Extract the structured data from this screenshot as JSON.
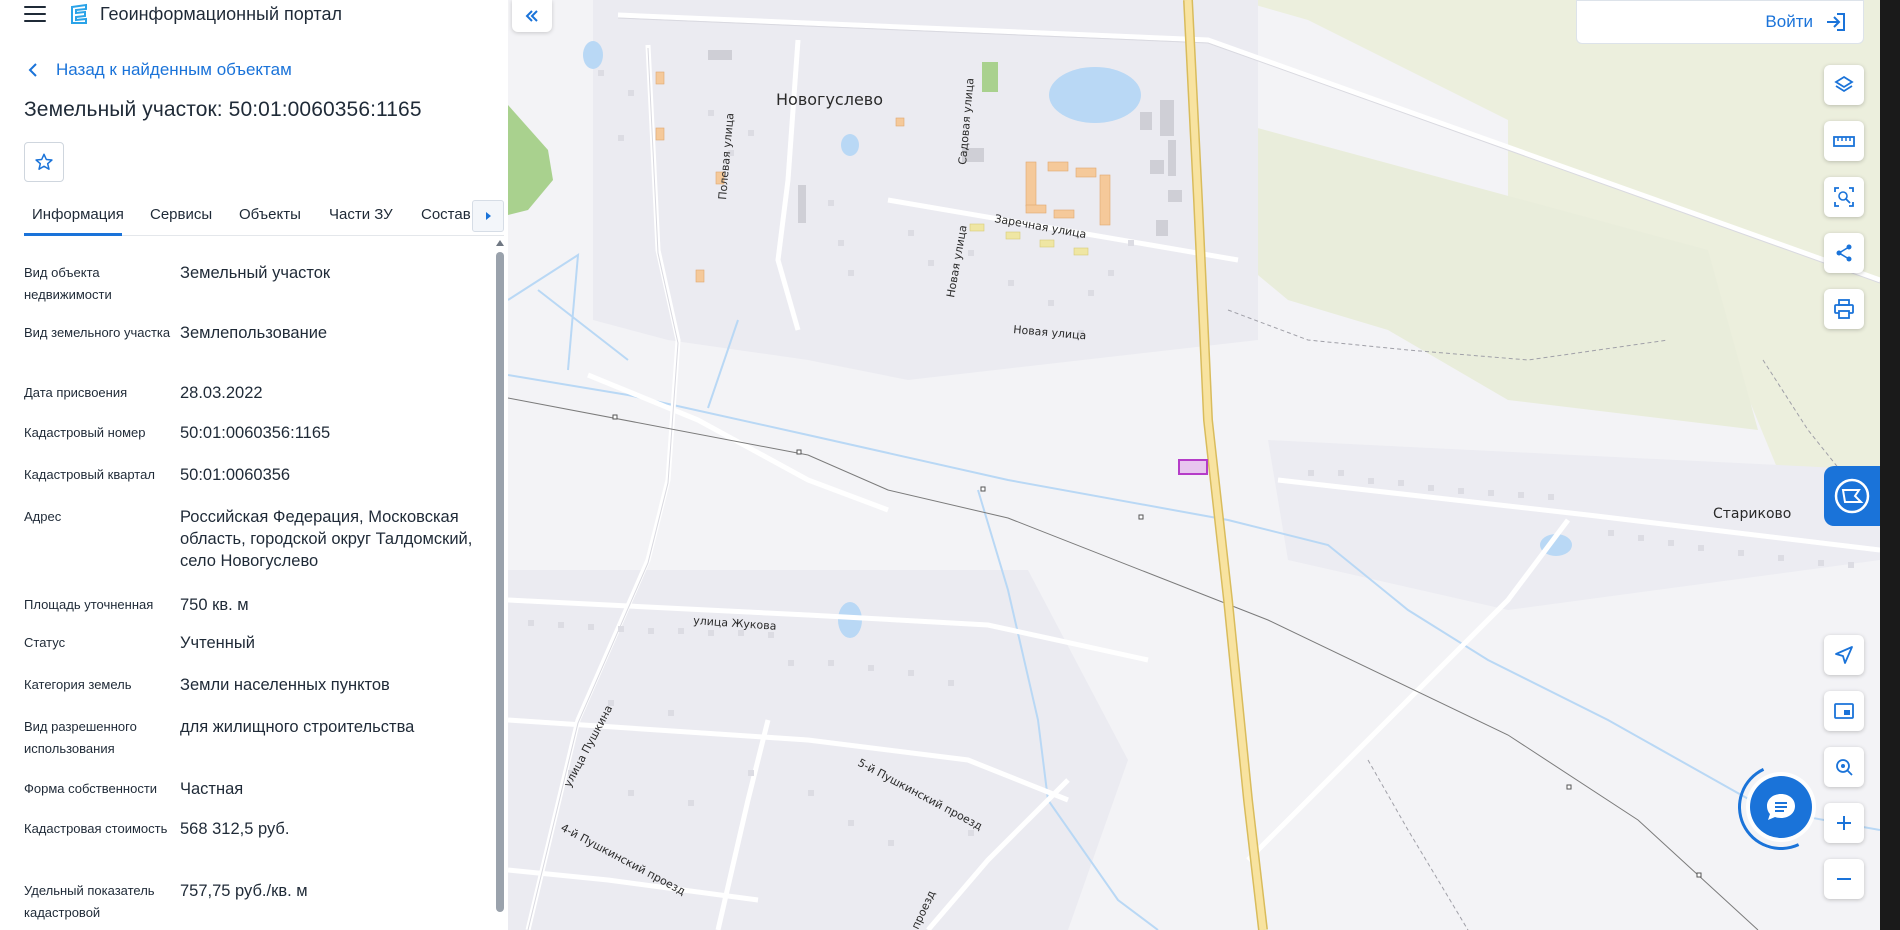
{
  "header": {
    "app_title": "Геоинформационный портал",
    "menu_icon": "hamburger-menu-icon",
    "logo_icon": "portal-logo-icon"
  },
  "panel": {
    "back_label": "Назад к найденным объектам",
    "object_title": "Земельный участок: 50:01:0060356:1165",
    "tabs": [
      {
        "label": "Информация",
        "active": true
      },
      {
        "label": "Сервисы",
        "active": false
      },
      {
        "label": "Объекты",
        "active": false
      },
      {
        "label": "Части ЗУ",
        "active": false
      },
      {
        "label": "Состав",
        "active": false
      }
    ],
    "properties": [
      {
        "label": "Вид объекта недвижимости",
        "value": "Земельный участок"
      },
      {
        "label": "Вид земельного участка",
        "value": "Землепользование"
      },
      {
        "label": "Дата присвоения",
        "value": "28.03.2022"
      },
      {
        "label": "Кадастровый номер",
        "value": "50:01:0060356:1165"
      },
      {
        "label": "Кадастровый квартал",
        "value": "50:01:0060356"
      },
      {
        "label": "Адрес",
        "value": "Российская Федерация, Московская область, городской округ Талдомский, село Новогуслево"
      },
      {
        "label": "Площадь уточненная",
        "value": "750 кв. м"
      },
      {
        "label": "Статус",
        "value": "Учтенный"
      },
      {
        "label": "Категория земель",
        "value": "Земли населенных пунктов"
      },
      {
        "label": "Вид разрешенного использования",
        "value": "для жилищного строительства"
      },
      {
        "label": "Форма собственности",
        "value": "Частная"
      },
      {
        "label": "Кадастровая стоимость",
        "value": "568 312,5 руб."
      },
      {
        "label": "Удельный показатель кадастровой",
        "value": "757,75 руб./кв. м"
      }
    ]
  },
  "map": {
    "login_label": "Войти",
    "labels": {
      "village_1": "Новогуслево",
      "village_2": "Стариково",
      "street_polevaya": "Полевая улица",
      "street_sadovaya": "Садовая улица",
      "street_zarechnaya": "Заречная улица",
      "street_novaya_v": "Новая улица",
      "street_novaya_h": "Новая улица",
      "street_zhukova": "улица Жукова",
      "street_pushkina": "улица Пушкина",
      "street_5pushk": "5-й Пушкинский проезд",
      "street_4pushk": "4-й Пушкинский проезд",
      "street_proezd": "проезд"
    },
    "tools": [
      "layers-icon",
      "ruler-icon",
      "area-select-icon",
      "share-icon",
      "print-icon",
      "locate-icon",
      "minimap-icon",
      "geo-search-icon",
      "zoom-in-icon",
      "zoom-out-icon"
    ],
    "colors": {
      "road_major": "#f5d77a",
      "water": "#b9d8f5",
      "park": "#a9d18e",
      "field": "#ecefdd",
      "parcel": "#b53cc8",
      "accent": "#1a73d9"
    }
  }
}
